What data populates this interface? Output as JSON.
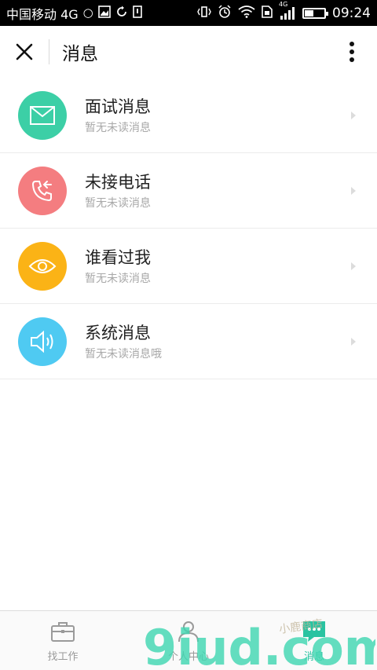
{
  "status_bar": {
    "carrier": "中国移动 4G",
    "network": "4G",
    "time": "09:24",
    "battery_level": 0.45
  },
  "header": {
    "title": "消息",
    "close_icon": "close-icon",
    "more_icon": "more-vertical-icon"
  },
  "messages": [
    {
      "title": "面试消息",
      "subtitle": "暂无未读消息",
      "icon": "envelope-icon",
      "color": "#3ccfa6"
    },
    {
      "title": "未接电话",
      "subtitle": "暂无未读消息",
      "icon": "missed-call-icon",
      "color": "#f47d80"
    },
    {
      "title": "谁看过我",
      "subtitle": "暂无未读消息",
      "icon": "eye-icon",
      "color": "#fbb316"
    },
    {
      "title": "系统消息",
      "subtitle": "暂无未读消息哦",
      "icon": "speaker-icon",
      "color": "#4fcaf2"
    }
  ],
  "bottom_nav": [
    {
      "label": "找工作",
      "icon": "briefcase-icon",
      "active": false
    },
    {
      "label": "个人中心",
      "icon": "person-icon",
      "active": false
    },
    {
      "label": "消息",
      "icon": "chat-icon",
      "active": true
    }
  ],
  "watermark": {
    "text": "9iud.com",
    "caption": "小鹿商店"
  },
  "colors": {
    "accent": "#29c3a1",
    "subtitle_gray": "#a8a8a8"
  }
}
